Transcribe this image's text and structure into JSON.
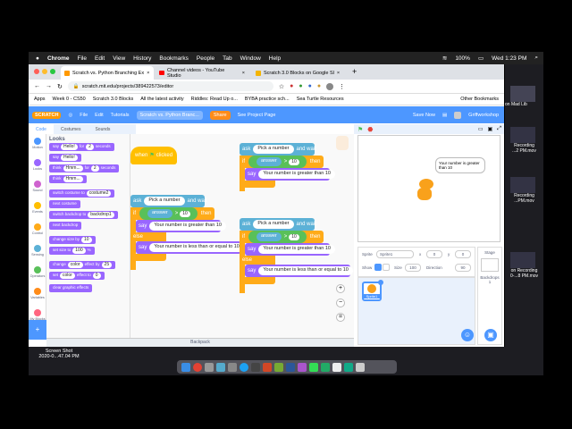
{
  "menubar": {
    "app": "Chrome",
    "items": [
      "File",
      "Edit",
      "View",
      "History",
      "Bookmarks",
      "People",
      "Tab",
      "Window",
      "Help"
    ],
    "battery": "100%",
    "clock": "Wed 1:23 PM"
  },
  "tabs": [
    {
      "label": "Scratch vs. Python Branching Ex",
      "active": true
    },
    {
      "label": "Channel videos - YouTube Studio",
      "active": false
    },
    {
      "label": "Scratch 3.0 Blocks on Google Sl",
      "active": false
    }
  ],
  "address": {
    "url": "scratch.mit.edu/projects/389422573/editor"
  },
  "bookmarks": [
    "Apps",
    "Week 0 - CS50",
    "Scratch 3.0 Blocks",
    "All the latest activity",
    "Riddles: Read Up o...",
    "BYBA practice sch...",
    "Sea Turtle Resources"
  ],
  "other_bookmarks": "Other Bookmarks",
  "scratch": {
    "menu": [
      "File",
      "Edit",
      "Tutorials"
    ],
    "project_title": "Scratch vs. Python Branc...",
    "share": "Share",
    "see_project": "See Project Page",
    "save_now": "Save Now",
    "user": "Griffworkshop",
    "editor_tabs": [
      "Code",
      "Costumes",
      "Sounds"
    ],
    "categories": [
      {
        "label": "Motion",
        "color": "#4c97ff"
      },
      {
        "label": "Looks",
        "color": "#9966ff"
      },
      {
        "label": "Sound",
        "color": "#cf63cf"
      },
      {
        "label": "Events",
        "color": "#ffbf00"
      },
      {
        "label": "Control",
        "color": "#ffab19"
      },
      {
        "label": "Sensing",
        "color": "#5cb1d6"
      },
      {
        "label": "Operators",
        "color": "#59c059"
      },
      {
        "label": "Variables",
        "color": "#ff8c1a"
      },
      {
        "label": "My Blocks",
        "color": "#ff6680"
      }
    ],
    "palette": {
      "heading": "Looks",
      "blocks": [
        {
          "kw": "say",
          "val": "Hello!",
          "kw2": "for",
          "n": "2",
          "kw3": "seconds"
        },
        {
          "kw": "say",
          "val": "Hello!"
        },
        {
          "kw": "think",
          "val": "Hmm...",
          "kw2": "for",
          "n": "2",
          "kw3": "seconds"
        },
        {
          "kw": "think",
          "val": "Hmm..."
        },
        {
          "kw": "switch costume to",
          "val": "costume2"
        },
        {
          "kw": "next costume"
        },
        {
          "kw": "switch backdrop to",
          "val": "backdrop1"
        },
        {
          "kw": "next backdrop"
        },
        {
          "kw": "change size by",
          "val": "10"
        },
        {
          "kw": "set size to",
          "val": "100",
          "kw2": "%"
        },
        {
          "kw": "change",
          "val": "color",
          "kw2": "effect by",
          "n": "25"
        },
        {
          "kw": "set",
          "val": "color",
          "kw2": "effect to",
          "n": "0"
        },
        {
          "kw": "clear graphic effects"
        }
      ]
    },
    "when_flag": {
      "prefix": "when",
      "suffix": "clicked"
    },
    "scripts": [
      {
        "ask": "ask",
        "prompt": "Pick a number",
        "wait": "and wait",
        "if": "if",
        "answer": "answer",
        "op": ">",
        "value": "10",
        "then": "then",
        "say": "say",
        "msg_true": "Your number is greater than 10",
        "else": "else",
        "msg_false": "Your number is less than or equal to 10"
      },
      {
        "ask": "ask",
        "prompt": "Pick a number",
        "wait": "and wait",
        "if": "if",
        "answer": "answer",
        "op": ">",
        "value": "10",
        "then": "then",
        "say": "say",
        "msg_true": "Your number is greater than 10"
      },
      {
        "ask": "ask",
        "prompt": "Pick a number",
        "wait": "and wait",
        "if": "if",
        "answer": "answer",
        "op": ">",
        "value": "10",
        "then": "then",
        "say": "say",
        "msg_true": "Your number is greater than 10",
        "else": "else",
        "msg_false": "Your number is less than or equal to 10"
      }
    ],
    "backpack": "Backpack",
    "stage": {
      "speech": "Your number is greater than 10"
    },
    "sprite_info": {
      "sprite_label": "Sprite",
      "sprite_name": "Sprite1",
      "x_label": "x",
      "x": "0",
      "y_label": "y",
      "y": "0",
      "show_label": "Show",
      "size_label": "Size",
      "size": "100",
      "direction_label": "Direction",
      "direction": "90"
    },
    "sprite_tile": "Sprite1",
    "stage_panel": {
      "title": "Stage",
      "backdrops_label": "Backdrops",
      "backdrops": "1"
    }
  },
  "desktop": [
    {
      "name": "on Mad Lib"
    },
    {
      "name": "Recording",
      "sub": "...2 PM.mov"
    },
    {
      "name": "Recording",
      "sub": "...PM.mov"
    },
    {
      "name": "on Recording",
      "sub": "0-...8 PM.mov"
    },
    {
      "name": "Screen Shot",
      "sub": "2020-0...47.04 PM"
    }
  ]
}
